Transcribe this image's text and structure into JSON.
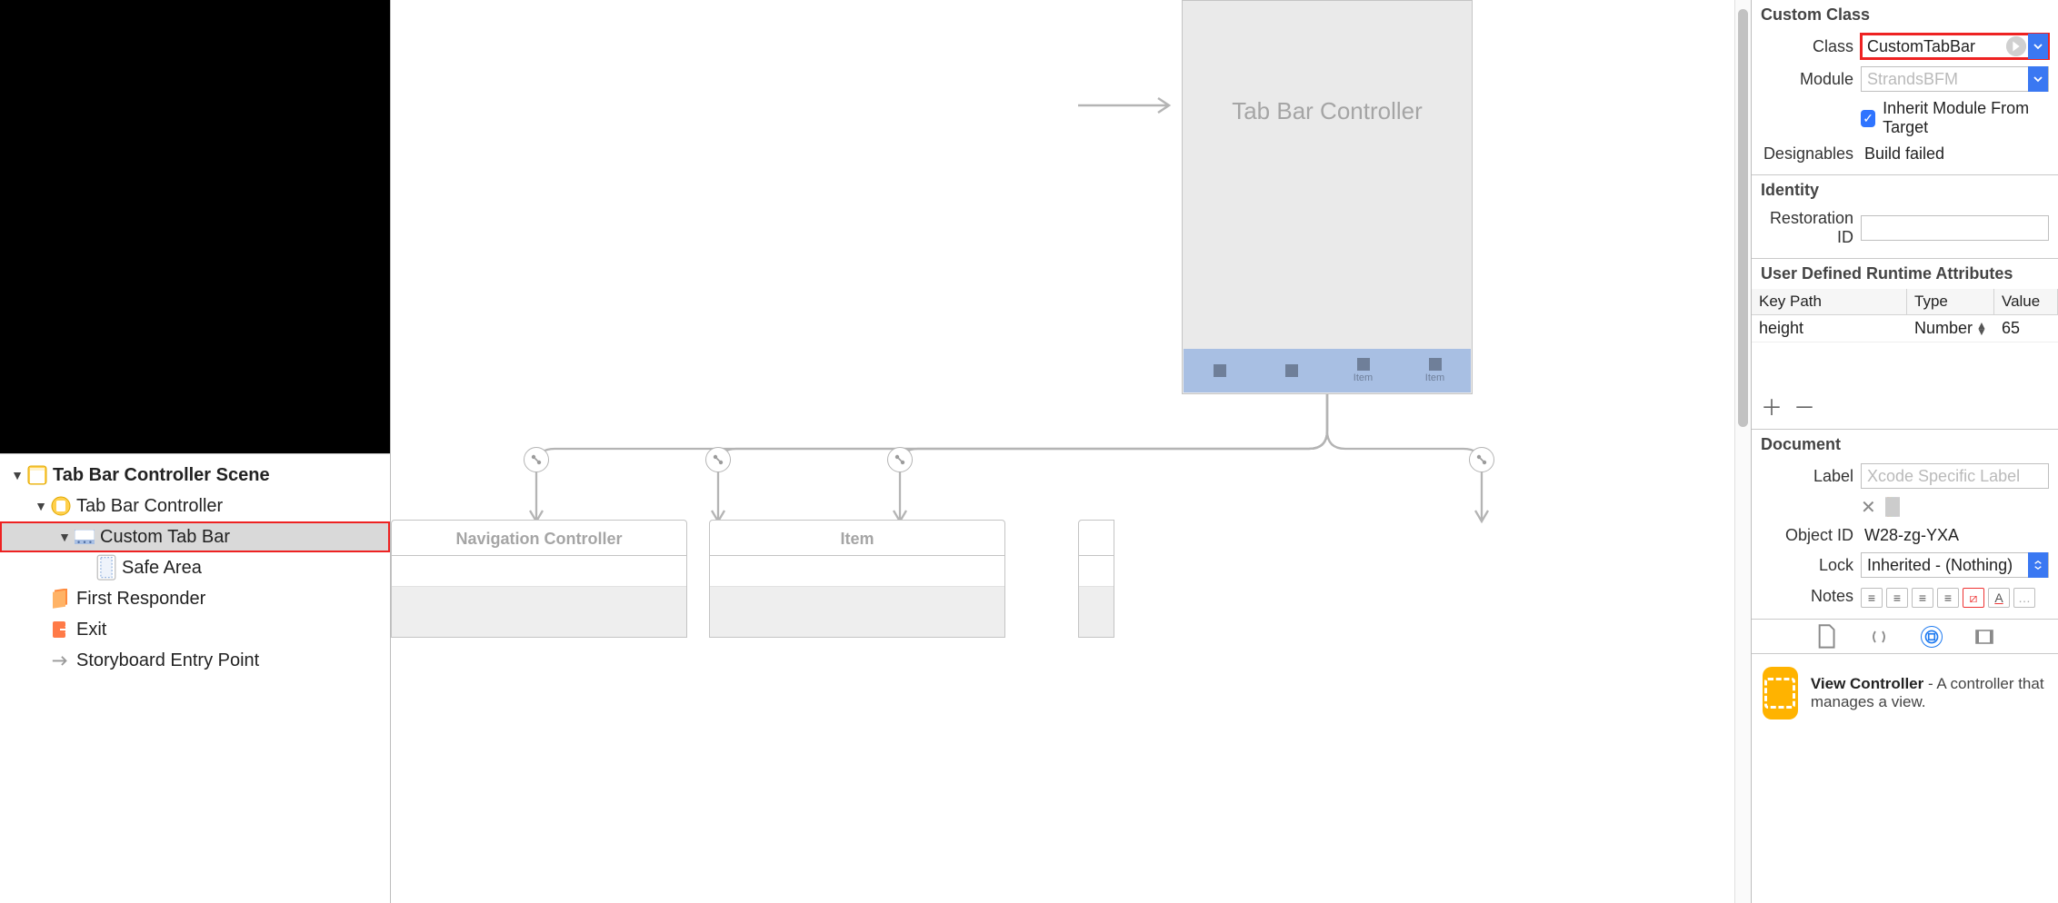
{
  "sidebar": {
    "scene_title": "Tab Bar Controller Scene",
    "items": {
      "tabbar_controller": "Tab Bar Controller",
      "custom_tabbar": "Custom Tab Bar",
      "safe_area": "Safe Area",
      "first_responder": "First Responder",
      "exit": "Exit",
      "entry_point": "Storyboard Entry Point"
    }
  },
  "canvas": {
    "tabbar_title": "Tab Bar Controller",
    "tab_items": [
      "",
      "",
      "Item",
      "Item"
    ],
    "dest_boxes": [
      {
        "title": "Navigation Controller"
      },
      {
        "title": "Item"
      },
      {
        "title": ""
      }
    ]
  },
  "inspector": {
    "custom_class_section": "Custom Class",
    "class_label": "Class",
    "class_value": "CustomTabBar",
    "module_label": "Module",
    "module_placeholder": "StrandsBFM",
    "inherit_label": "Inherit Module From Target",
    "designables_label": "Designables",
    "designables_value": "Build failed",
    "identity_section": "Identity",
    "restoration_label": "Restoration ID",
    "restoration_value": "",
    "runtime_section": "User Defined Runtime Attributes",
    "runtime_headers": {
      "key": "Key Path",
      "type": "Type",
      "val": "Value"
    },
    "runtime_rows": [
      {
        "key": "height",
        "type": "Number",
        "val": "65"
      }
    ],
    "document_section": "Document",
    "label_label": "Label",
    "label_placeholder": "Xcode Specific Label",
    "swatch_colors": [
      "#fffffe",
      "#f48a67",
      "#f7c95d",
      "#aee28a",
      "#8dd7ef",
      "#b8a8ee",
      "#e7b1e1",
      "#e0e0e0"
    ],
    "objectid_label": "Object ID",
    "objectid_value": "W28-zg-YXA",
    "lock_label": "Lock",
    "lock_value": "Inherited - (Nothing)",
    "notes_label": "Notes",
    "library_item": {
      "title": "View Controller",
      "desc": " - A controller that manages a view."
    }
  }
}
